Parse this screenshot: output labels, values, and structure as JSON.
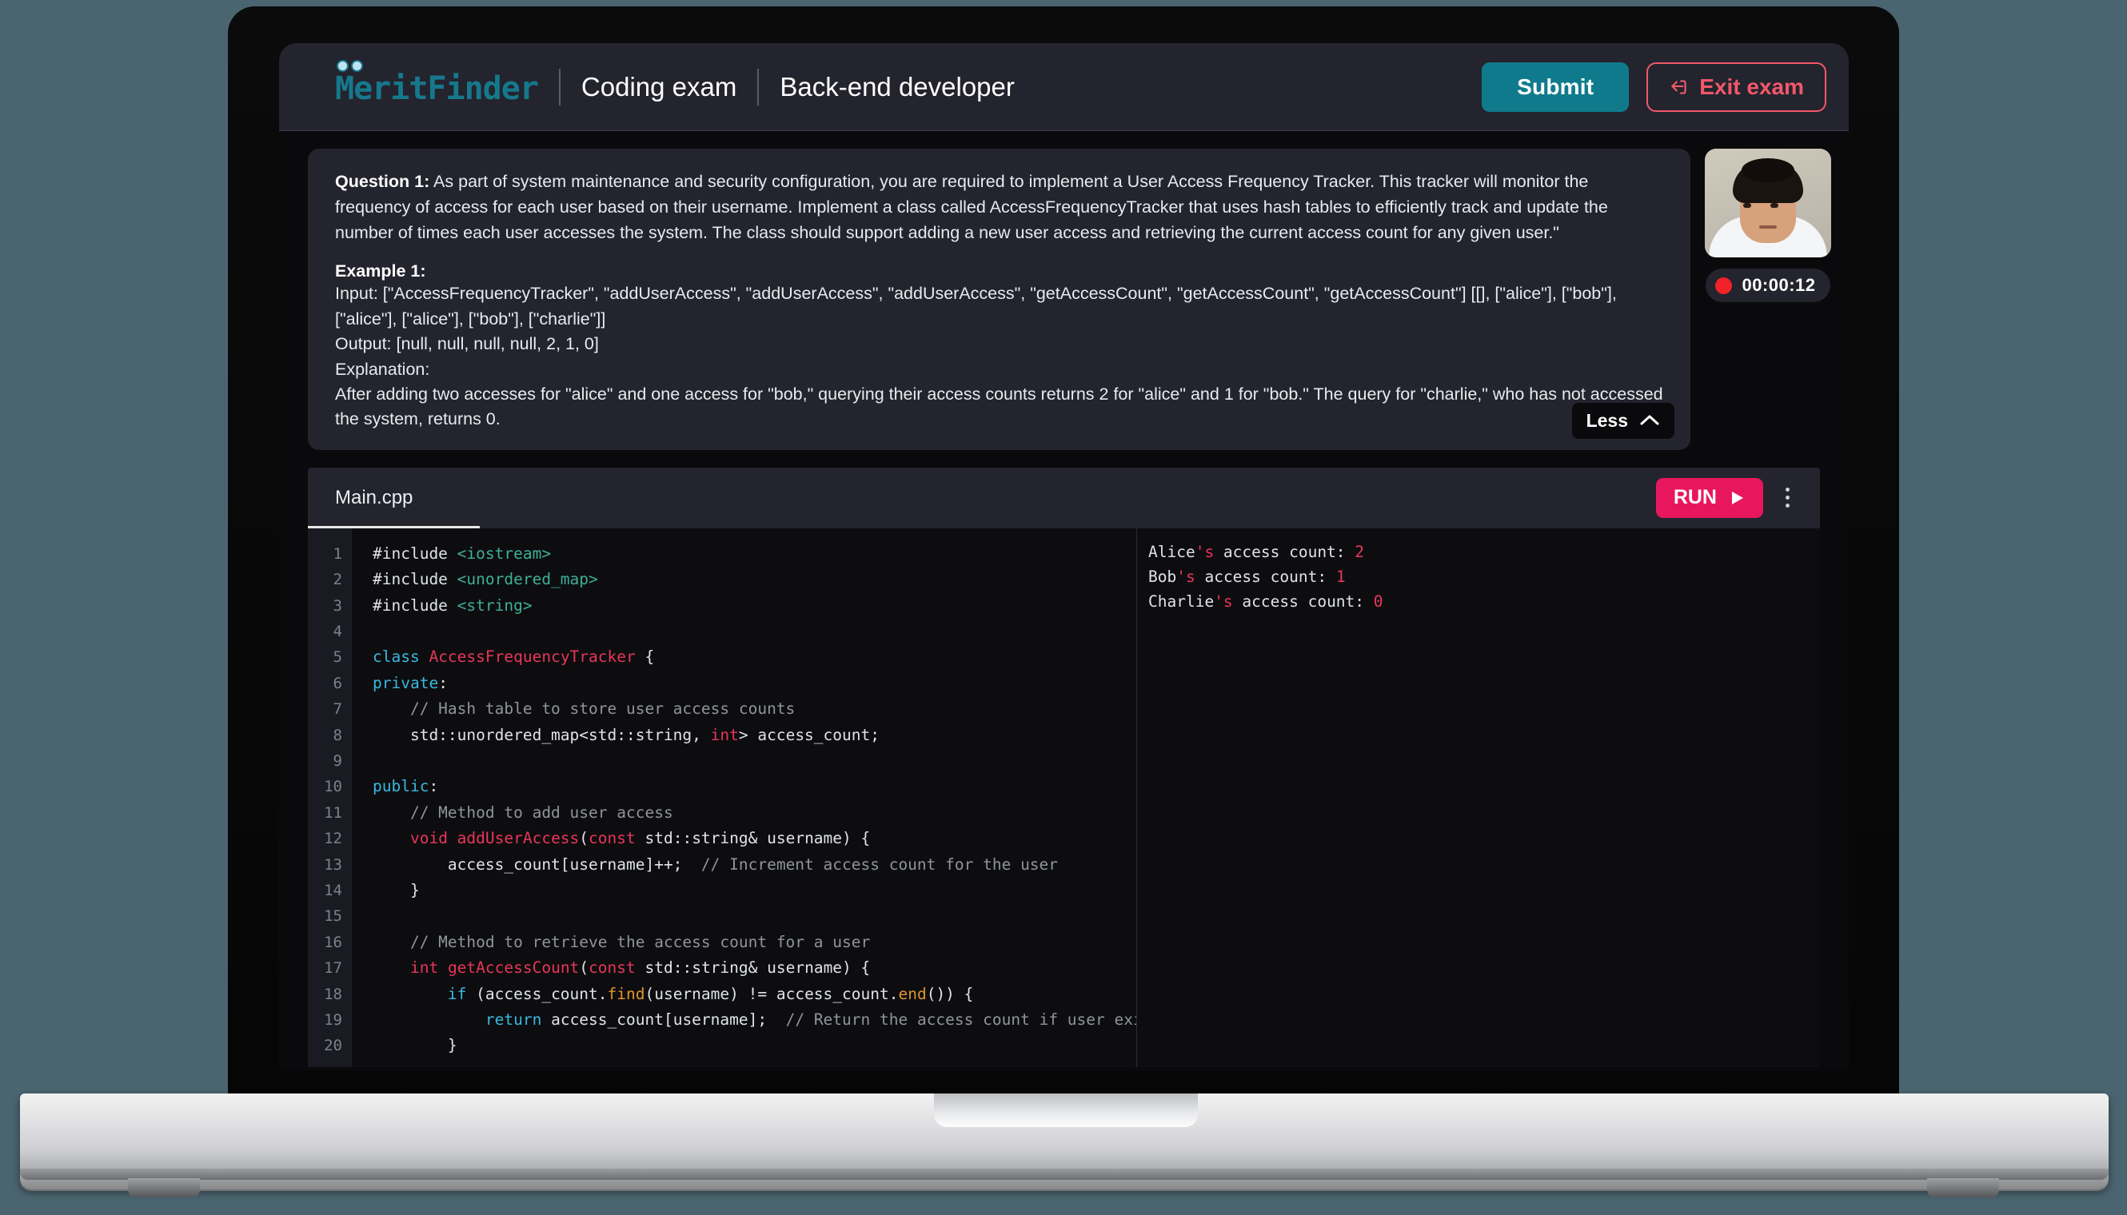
{
  "brand": {
    "name": "MeritFinder",
    "color": "#16788c"
  },
  "header": {
    "exam_type": "Coding exam",
    "role": "Back-end developer",
    "submit_label": "Submit",
    "exit_label": "Exit exam"
  },
  "question": {
    "label": "Question 1:",
    "prompt": " As part of system maintenance and security configuration, you are required to implement a User Access Frequency Tracker. This tracker will monitor the frequency of access for each user based on their username. Implement a class called AccessFrequencyTracker that uses hash tables to efficiently track and update the number of times each user accesses the system. The class should support adding a new user access and retrieving the current access count for any given user.\"",
    "example_label": "Example 1:",
    "input_line": "Input: [\"AccessFrequencyTracker\", \"addUserAccess\", \"addUserAccess\", \"addUserAccess\", \"getAccessCount\", \"getAccessCount\", \"getAccessCount\"] [[], [\"alice\"], [\"bob\"], [\"alice\"], [\"alice\"], [\"bob\"], [\"charlie\"]]",
    "output_line": "Output: [null, null, null, null, 2, 1, 0]",
    "explanation_label": "Explanation:",
    "explanation_line": "After adding two accesses for \"alice\" and one access for \"bob,\" querying their access counts returns 2 for \"alice\" and 1 for \"bob.\" The query for \"charlie,\" who has not accessed the system, returns 0.",
    "collapse_label": "Less"
  },
  "proctor": {
    "timer": "00:00:12",
    "recording_color": "#f0232a"
  },
  "editor": {
    "tab_label": "Main.cpp",
    "run_label": "RUN",
    "run_color": "#e8175d",
    "line_numbers": [
      "1",
      "2",
      "3",
      "4",
      "5",
      "6",
      "7",
      "8",
      "9",
      "10",
      "11",
      "12",
      "13",
      "14",
      "15",
      "16",
      "17",
      "18",
      "19",
      "20"
    ],
    "code_lines": [
      [
        {
          "t": "#include ",
          "c": "pl"
        },
        {
          "t": "<iostream>",
          "c": "i"
        }
      ],
      [
        {
          "t": "#include ",
          "c": "pl"
        },
        {
          "t": "<unordered_map>",
          "c": "i"
        }
      ],
      [
        {
          "t": "#include ",
          "c": "pl"
        },
        {
          "t": "<string>",
          "c": "i"
        }
      ],
      [],
      [
        {
          "t": "class ",
          "c": "k"
        },
        {
          "t": "AccessFrequencyTracker",
          "c": "t"
        },
        {
          "t": " {",
          "c": "pl"
        }
      ],
      [
        {
          "t": "private",
          "c": "k"
        },
        {
          "t": ":",
          "c": "pl"
        }
      ],
      [
        {
          "t": "    // Hash table to store user access counts",
          "c": "c"
        }
      ],
      [
        {
          "t": "    std::unordered_map<std::string, ",
          "c": "pl"
        },
        {
          "t": "int",
          "c": "kr"
        },
        {
          "t": "> access_count;",
          "c": "pl"
        }
      ],
      [],
      [
        {
          "t": "public",
          "c": "k"
        },
        {
          "t": ":",
          "c": "pl"
        }
      ],
      [
        {
          "t": "    // Method to add user access",
          "c": "c"
        }
      ],
      [
        {
          "t": "    ",
          "c": "pl"
        },
        {
          "t": "void ",
          "c": "kr"
        },
        {
          "t": "addUserAccess",
          "c": "t"
        },
        {
          "t": "(",
          "c": "pl"
        },
        {
          "t": "const",
          "c": "kr"
        },
        {
          "t": " std::string& username) {",
          "c": "pl"
        }
      ],
      [
        {
          "t": "        access_count[username]++;  ",
          "c": "pl"
        },
        {
          "t": "// Increment access count for the user",
          "c": "c"
        }
      ],
      [
        {
          "t": "    }",
          "c": "pl"
        }
      ],
      [],
      [
        {
          "t": "    // Method to retrieve the access count for a user",
          "c": "c"
        }
      ],
      [
        {
          "t": "    ",
          "c": "pl"
        },
        {
          "t": "int ",
          "c": "kr"
        },
        {
          "t": "getAccessCount",
          "c": "t"
        },
        {
          "t": "(",
          "c": "pl"
        },
        {
          "t": "const",
          "c": "kr"
        },
        {
          "t": " std::string& username) {",
          "c": "pl"
        }
      ],
      [
        {
          "t": "        ",
          "c": "pl"
        },
        {
          "t": "if",
          "c": "k"
        },
        {
          "t": " (access_count.",
          "c": "pl"
        },
        {
          "t": "find",
          "c": "fn"
        },
        {
          "t": "(username) != access_count.",
          "c": "pl"
        },
        {
          "t": "end",
          "c": "fn"
        },
        {
          "t": "()) {",
          "c": "pl"
        }
      ],
      [
        {
          "t": "            ",
          "c": "pl"
        },
        {
          "t": "return",
          "c": "k"
        },
        {
          "t": " access_count[username];  ",
          "c": "pl"
        },
        {
          "t": "// Return the access count if user exis",
          "c": "c"
        }
      ],
      [
        {
          "t": "        }",
          "c": "pl"
        }
      ]
    ],
    "output_lines": [
      [
        {
          "t": "Alice",
          "c": "pl"
        },
        {
          "t": "'s",
          "c": "oap"
        },
        {
          "t": " access count: ",
          "c": "pl"
        },
        {
          "t": "2",
          "c": "onum"
        }
      ],
      [
        {
          "t": "Bob",
          "c": "pl"
        },
        {
          "t": "'s",
          "c": "oap"
        },
        {
          "t": " access count: ",
          "c": "pl"
        },
        {
          "t": "1",
          "c": "onum"
        }
      ],
      [
        {
          "t": "Charlie",
          "c": "pl"
        },
        {
          "t": "'s",
          "c": "oap"
        },
        {
          "t": " access count: ",
          "c": "pl"
        },
        {
          "t": "0",
          "c": "onum"
        }
      ]
    ]
  }
}
